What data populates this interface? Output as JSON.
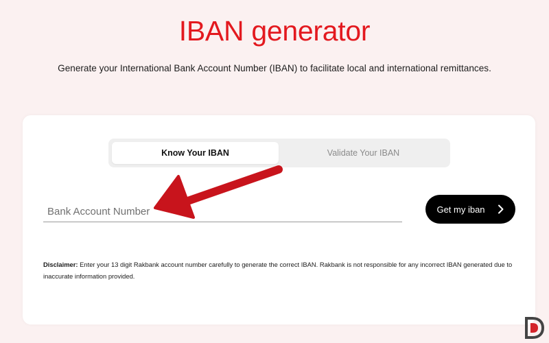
{
  "header": {
    "title": "IBAN generator",
    "subtitle": "Generate your International Bank Account Number (IBAN) to facilitate local and international remittances."
  },
  "tabs": [
    {
      "label": "Know Your IBAN",
      "active": true
    },
    {
      "label": "Validate Your IBAN",
      "active": false
    }
  ],
  "form": {
    "account_number": {
      "value": "",
      "placeholder": "Bank Account Number"
    },
    "submit_label": "Get my iban"
  },
  "disclaimer": {
    "label": "Disclaimer:",
    "text": " Enter your 13 digit Rakbank account number carefully to generate the correct IBAN. Rakbank is not responsible for any incorrect IBAN generated due to inaccurate information provided."
  },
  "colors": {
    "accent": "#e3191f",
    "annotation_arrow": "#c8141c",
    "background": "#fbf1f1",
    "button": "#000000"
  },
  "icons": {
    "submit": "chevron-right-icon",
    "annotation": "arrow-pointer-icon",
    "watermark": "d-logo-icon"
  }
}
